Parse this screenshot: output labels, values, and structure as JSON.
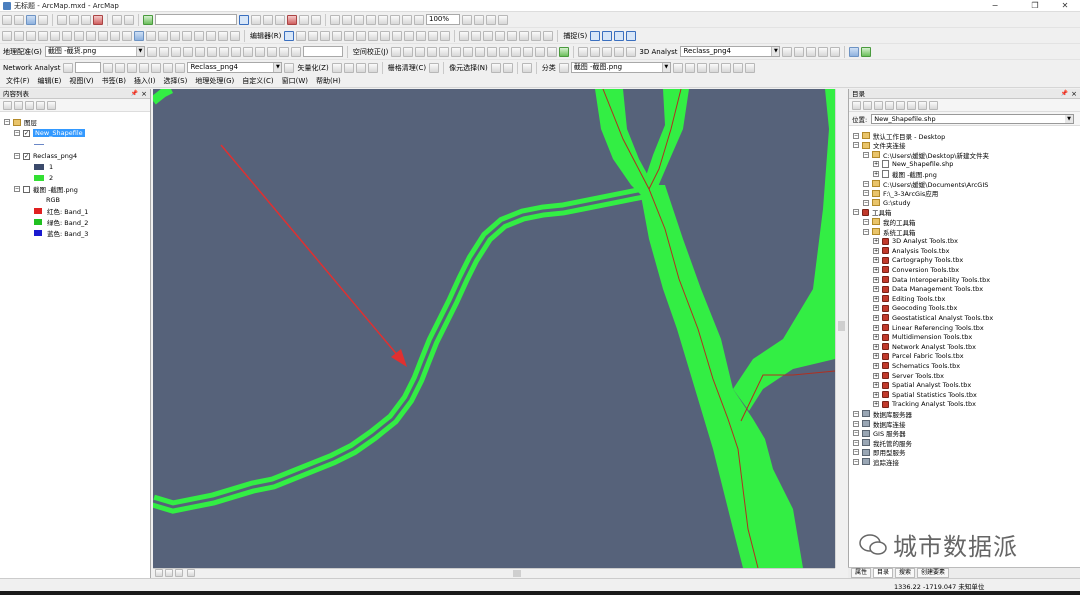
{
  "window": {
    "title": "无标题 - ArcMap.mxd - ArcMap",
    "controls": [
      "−",
      "❐",
      "✕"
    ]
  },
  "toolbars": {
    "scale_input": "",
    "zoom_percent": "100%",
    "editor_label": "编辑器(R)",
    "georef_label": "地理配准(G)",
    "georef_layer": "截图 -截货.png",
    "georef_tool_label": "空间校正(J)",
    "spatial_adj_layer": "",
    "layer_3d_label": "3D Analyst",
    "layer_3d_value": "Reclass_png4",
    "catch_label": "捕捉(S)",
    "network_label": "Network Analyst",
    "network_layer": "Reclass_png4",
    "vectorize_label": "矢量化(Z)",
    "raster_cleanup": "栅格清理(C)",
    "cell_select": "像元选择(N)",
    "classify_label": "分类",
    "classify_layer": "截图 -截图.png"
  },
  "menu": [
    "文件(F)",
    "编辑(E)",
    "视图(V)",
    "书签(B)",
    "插入(I)",
    "选择(S)",
    "地理处理(G)",
    "自定义(C)",
    "窗口(W)",
    "帮助(H)"
  ],
  "toc": {
    "title": "内容列表",
    "root": "图层",
    "items": [
      {
        "label": "New_Shapefile",
        "selected": true
      },
      {
        "label": "Reclass_png4"
      },
      {
        "label": "1",
        "color": "#3b4a6b"
      },
      {
        "label": "2",
        "color": "#33e033"
      },
      {
        "label": "截图 -截图.png"
      },
      {
        "label": "RGB"
      },
      {
        "label": "红色:  Band_1",
        "color": "#e02020"
      },
      {
        "label": "绿色:  Band_2",
        "color": "#20c020"
      },
      {
        "label": "蓝色:  Band_3",
        "color": "#1a1ad0"
      }
    ]
  },
  "catalog": {
    "title": "目录",
    "location_label": "位置:",
    "location_value": "New_Shapefile.shp",
    "tree": [
      {
        "label": "默认工作目录 - Desktop",
        "level": 0,
        "icon": "folder"
      },
      {
        "label": "文件夹连接",
        "level": 0,
        "icon": "folder"
      },
      {
        "label": "C:\\Users\\媛媛\\Desktop\\新建文件夹",
        "level": 1,
        "icon": "folder"
      },
      {
        "label": "New_Shapefile.shp",
        "level": 2,
        "icon": "doc"
      },
      {
        "label": "截图 -截图.png",
        "level": 2,
        "icon": "doc"
      },
      {
        "label": "C:\\Users\\媛媛\\Documents\\ArcGIS",
        "level": 1,
        "icon": "folder"
      },
      {
        "label": "F:\\_3-3ArcGis应用",
        "level": 1,
        "icon": "folder"
      },
      {
        "label": "G:\\study",
        "level": 1,
        "icon": "folder"
      },
      {
        "label": "工具箱",
        "level": 0,
        "icon": "tbx"
      },
      {
        "label": "我的工具箱",
        "level": 1,
        "icon": "folder"
      },
      {
        "label": "系统工具箱",
        "level": 1,
        "icon": "folder"
      },
      {
        "label": "3D Analyst Tools.tbx",
        "level": 2,
        "icon": "tbx"
      },
      {
        "label": "Analysis Tools.tbx",
        "level": 2,
        "icon": "tbx"
      },
      {
        "label": "Cartography Tools.tbx",
        "level": 2,
        "icon": "tbx"
      },
      {
        "label": "Conversion Tools.tbx",
        "level": 2,
        "icon": "tbx"
      },
      {
        "label": "Data Interoperability Tools.tbx",
        "level": 2,
        "icon": "tbx"
      },
      {
        "label": "Data Management Tools.tbx",
        "level": 2,
        "icon": "tbx"
      },
      {
        "label": "Editing Tools.tbx",
        "level": 2,
        "icon": "tbx"
      },
      {
        "label": "Geocoding Tools.tbx",
        "level": 2,
        "icon": "tbx"
      },
      {
        "label": "Geostatistical Analyst Tools.tbx",
        "level": 2,
        "icon": "tbx"
      },
      {
        "label": "Linear Referencing Tools.tbx",
        "level": 2,
        "icon": "tbx"
      },
      {
        "label": "Multidimension Tools.tbx",
        "level": 2,
        "icon": "tbx"
      },
      {
        "label": "Network Analyst Tools.tbx",
        "level": 2,
        "icon": "tbx"
      },
      {
        "label": "Parcel Fabric Tools.tbx",
        "level": 2,
        "icon": "tbx"
      },
      {
        "label": "Schematics Tools.tbx",
        "level": 2,
        "icon": "tbx"
      },
      {
        "label": "Server Tools.tbx",
        "level": 2,
        "icon": "tbx"
      },
      {
        "label": "Spatial Analyst Tools.tbx",
        "level": 2,
        "icon": "tbx"
      },
      {
        "label": "Spatial Statistics Tools.tbx",
        "level": 2,
        "icon": "tbx"
      },
      {
        "label": "Tracking Analyst Tools.tbx",
        "level": 2,
        "icon": "tbx"
      },
      {
        "label": "数据库服务器",
        "level": 0,
        "icon": "srv"
      },
      {
        "label": "数据库连接",
        "level": 0,
        "icon": "srv"
      },
      {
        "label": "GIS 服务器",
        "level": 0,
        "icon": "srv"
      },
      {
        "label": "我托管的服务",
        "level": 0,
        "icon": "srv"
      },
      {
        "label": "即用型服务",
        "level": 0,
        "icon": "srv"
      },
      {
        "label": "追踪连接",
        "level": 0,
        "icon": "srv"
      }
    ],
    "tabs": [
      "属性",
      "目录",
      "搜索",
      "创建要素"
    ]
  },
  "status": {
    "coordinates": "1336.22  -1719.047 未知单位"
  },
  "watermark": "城市数据派",
  "colors": {
    "map_bg": "#56627a",
    "raster_green": "#33ee44",
    "arrow": "#e03030",
    "line": "#b03020"
  }
}
